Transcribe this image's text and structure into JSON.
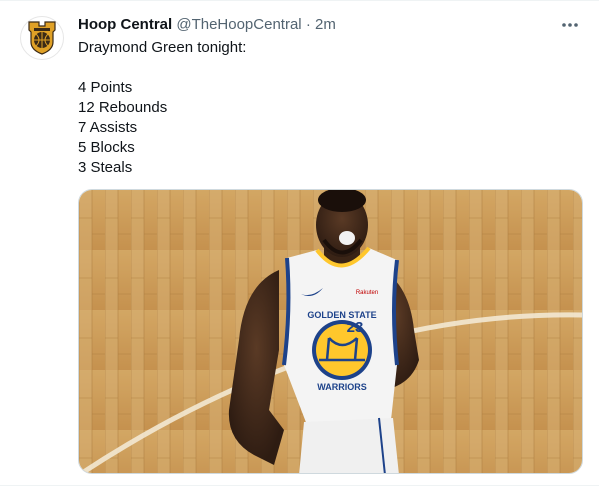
{
  "tweet": {
    "author_name": "Hoop Central",
    "author_handle": "@TheHoopCentral",
    "separator": "·",
    "time": "2m",
    "text_lines": [
      "Draymond Green tonight:",
      "",
      "4 Points",
      "12 Rebounds",
      "7 Assists",
      "5 Blocks",
      "3 Steals"
    ],
    "jersey_team_text": "GOLDEN STATE",
    "jersey_number": "23",
    "jersey_sponsor": "Rakuten",
    "jersey_bottom_text": "WARRIORS"
  },
  "icons": {
    "avatar": "hoop-central-logo",
    "more": "more-horizontal-icon"
  },
  "colors": {
    "text": "#0f1419",
    "secondary": "#536471",
    "border": "#cfd9de",
    "warriors_blue": "#1d428a",
    "warriors_gold": "#ffc72c"
  }
}
